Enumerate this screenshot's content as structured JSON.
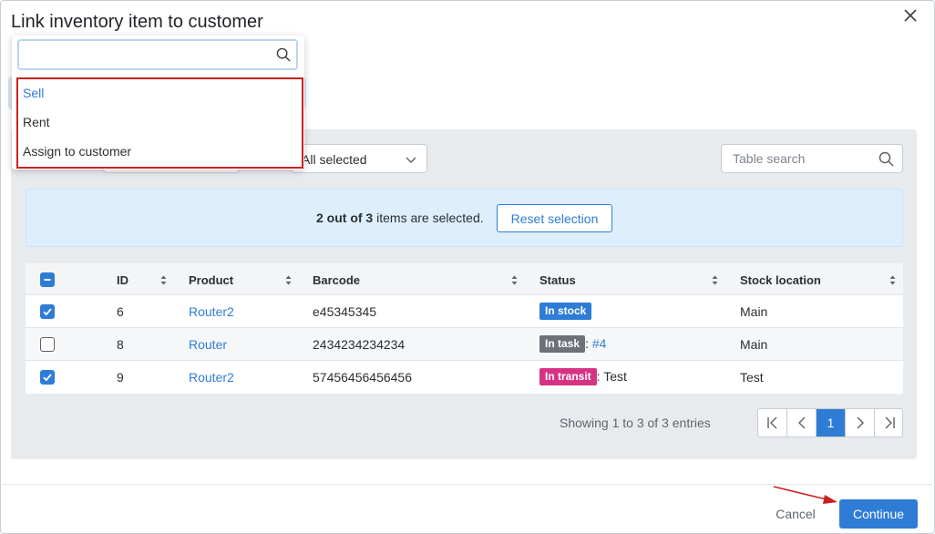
{
  "modal": {
    "title": "Link inventory item to customer"
  },
  "dropdown": {
    "search_value": "",
    "options": [
      {
        "label": "Sell",
        "selected": true
      },
      {
        "label": "Rent",
        "selected": false
      },
      {
        "label": "Assign to customer",
        "selected": false
      }
    ]
  },
  "filters": {
    "status_value": "All selected",
    "table_search_placeholder": "Table search"
  },
  "selection": {
    "count_bold": "2 out of 3",
    "suffix": "items are selected.",
    "reset_label": "Reset selection"
  },
  "table": {
    "columns": [
      "ID",
      "Product",
      "Barcode",
      "Status",
      "Stock location"
    ],
    "rows": [
      {
        "checked": true,
        "id": "6",
        "product": "Router2",
        "barcode": "e45345345",
        "status": "In stock",
        "status_extra": "",
        "status_link": "",
        "location": "Main"
      },
      {
        "checked": false,
        "id": "8",
        "product": "Router",
        "barcode": "2434234234234",
        "status": "In task",
        "status_extra": ":",
        "status_link": "#4",
        "location": "Main"
      },
      {
        "checked": true,
        "id": "9",
        "product": "Router2",
        "barcode": "57456456456456",
        "status": "In transit",
        "status_extra": ": Test",
        "status_link": "",
        "location": "Test"
      }
    ]
  },
  "pagination": {
    "summary": "Showing 1 to 3 of 3 entries",
    "current_page": "1"
  },
  "footer": {
    "cancel_label": "Cancel",
    "continue_label": "Continue"
  },
  "colors": {
    "accent": "#2f7cd6",
    "badge_in_stock": "#2f7cd6",
    "badge_in_task": "#6c7278",
    "badge_in_transit": "#d63384",
    "annotation_red": "#cc1f1f"
  },
  "icons": {
    "close": "close-icon",
    "search": "search-icon",
    "chevron": "chevron-down-icon",
    "sort": "sort-icon",
    "first_page": "first-page-icon",
    "prev_page": "chevron-left-icon",
    "next_page": "chevron-right-icon",
    "last_page": "last-page-icon"
  }
}
